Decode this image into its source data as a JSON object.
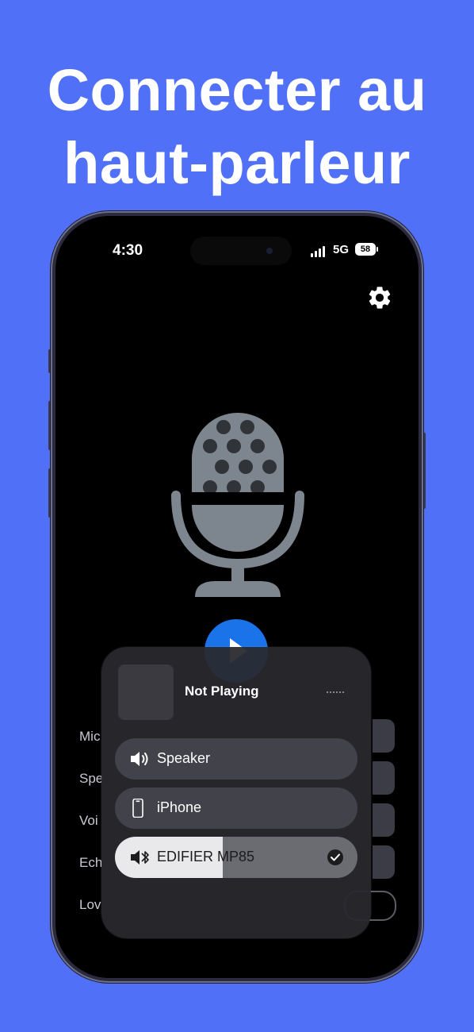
{
  "headline": {
    "line1": "Connecter au",
    "line2": "haut-parleur"
  },
  "status_bar": {
    "time": "4:30",
    "network": "5G",
    "battery": "58"
  },
  "settings_rows": [
    {
      "label": "Mic"
    },
    {
      "label": "Spe"
    },
    {
      "label": "Voi"
    },
    {
      "label": "Ech"
    },
    {
      "label": "Lov"
    }
  ],
  "audio_output": {
    "now_playing": "Not Playing",
    "routes": [
      {
        "label": "Speaker",
        "icon": "speaker-icon",
        "selected": false
      },
      {
        "label": "iPhone",
        "icon": "iphone-icon",
        "selected": false
      },
      {
        "label": "EDIFIER MP85",
        "icon": "bluetooth-speaker-icon",
        "selected": true
      }
    ]
  },
  "colors": {
    "background": "#5170f8",
    "play_button": "#1a73e8",
    "mic_gray": "#7d868e",
    "mic_dots": "#303438"
  }
}
